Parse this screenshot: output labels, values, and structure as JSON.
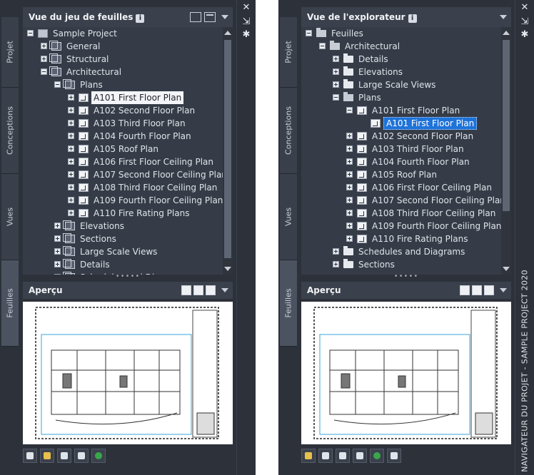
{
  "left": {
    "tabs": {
      "projet": "Projet",
      "conceptions": "Conceptions",
      "vues": "Vues",
      "feuilles": "Feuilles"
    },
    "title": "Vue du jeu de feuilles",
    "info": "i",
    "tree": [
      {
        "text": "Sample Project",
        "icon": "sheet-set-icon",
        "expander": "minus",
        "level": 0
      },
      {
        "text": "General",
        "icon": "subset-icon",
        "expander": "plus",
        "level": 1
      },
      {
        "text": "Structural",
        "icon": "subset-icon",
        "expander": "plus",
        "level": 1
      },
      {
        "text": "Architectural",
        "icon": "subset-icon",
        "expander": "minus",
        "level": 1
      },
      {
        "text": "Plans",
        "icon": "subset-icon",
        "expander": "minus",
        "level": 2
      },
      {
        "text": "A101 First Floor Plan",
        "icon": "sheet-icon",
        "expander": "plus",
        "level": 3,
        "selected": "gray"
      },
      {
        "text": "A102 Second Floor Plan",
        "icon": "sheet-icon",
        "expander": "plus",
        "level": 3
      },
      {
        "text": "A103 Third Floor Plan",
        "icon": "sheet-icon",
        "expander": "plus",
        "level": 3
      },
      {
        "text": "A104 Fourth Floor Plan",
        "icon": "sheet-icon",
        "expander": "plus",
        "level": 3
      },
      {
        "text": "A105 Roof Plan",
        "icon": "sheet-icon",
        "expander": "plus",
        "level": 3
      },
      {
        "text": "A106 First Floor Ceiling Plan",
        "icon": "sheet-icon",
        "expander": "plus",
        "level": 3
      },
      {
        "text": "A107 Second Floor Ceiling Plan",
        "icon": "sheet-icon",
        "expander": "plus",
        "level": 3
      },
      {
        "text": "A108 Third Floor Ceiling Plan",
        "icon": "sheet-icon",
        "expander": "plus",
        "level": 3
      },
      {
        "text": "A109 Fourth Floor Ceiling Plan",
        "icon": "sheet-icon",
        "expander": "plus",
        "level": 3
      },
      {
        "text": "A110 Fire Rating Plans",
        "icon": "sheet-icon",
        "expander": "plus",
        "level": 3
      },
      {
        "text": "Elevations",
        "icon": "subset-icon",
        "expander": "plus",
        "level": 2
      },
      {
        "text": "Sections",
        "icon": "subset-icon",
        "expander": "plus",
        "level": 2
      },
      {
        "text": "Large Scale Views",
        "icon": "subset-icon",
        "expander": "plus",
        "level": 2
      },
      {
        "text": "Details",
        "icon": "subset-icon",
        "expander": "plus",
        "level": 2
      },
      {
        "text": "Schedules and Diagrams",
        "icon": "subset-icon",
        "expander": "plus",
        "level": 2
      }
    ],
    "preview_title": "Aperçu"
  },
  "right": {
    "tabs": {
      "projet": "Projet",
      "conceptions": "Conceptions",
      "vues": "Vues",
      "feuilles": "Feuilles"
    },
    "title": "Vue de l'explorateur",
    "info": "i",
    "tree": [
      {
        "text": "Feuilles",
        "icon": "folder-open-icon",
        "expander": "minus",
        "level": 0
      },
      {
        "text": "Architectural",
        "icon": "folder-open-icon",
        "expander": "minus",
        "level": 1
      },
      {
        "text": "Details",
        "icon": "folder-icon",
        "expander": "plus",
        "level": 2
      },
      {
        "text": "Elevations",
        "icon": "folder-icon",
        "expander": "plus",
        "level": 2
      },
      {
        "text": "Large Scale Views",
        "icon": "folder-icon",
        "expander": "plus",
        "level": 2
      },
      {
        "text": "Plans",
        "icon": "folder-open-icon",
        "expander": "minus",
        "level": 2
      },
      {
        "text": "A101 First Floor Plan",
        "icon": "sheet-icon",
        "expander": "minus",
        "level": 3
      },
      {
        "text": "A101 First Floor Plan",
        "icon": "sheet-icon",
        "expander": "",
        "level": 4,
        "selected": "blue"
      },
      {
        "text": "A102 Second Floor Plan",
        "icon": "sheet-icon",
        "expander": "plus",
        "level": 3
      },
      {
        "text": "A103 Third Floor Plan",
        "icon": "sheet-icon",
        "expander": "plus",
        "level": 3
      },
      {
        "text": "A104 Fourth Floor Plan",
        "icon": "sheet-icon",
        "expander": "plus",
        "level": 3
      },
      {
        "text": "A105 Roof Plan",
        "icon": "sheet-icon",
        "expander": "plus",
        "level": 3
      },
      {
        "text": "A106 First Floor Ceiling Plan",
        "icon": "sheet-icon",
        "expander": "plus",
        "level": 3
      },
      {
        "text": "A107 Second Floor Ceiling Plan",
        "icon": "sheet-icon",
        "expander": "plus",
        "level": 3
      },
      {
        "text": "A108 Third Floor Ceiling Plan",
        "icon": "sheet-icon",
        "expander": "plus",
        "level": 3
      },
      {
        "text": "A109 Fourth Floor Ceiling Plan",
        "icon": "sheet-icon",
        "expander": "plus",
        "level": 3
      },
      {
        "text": "A110 Fire Rating Plans",
        "icon": "sheet-icon",
        "expander": "plus",
        "level": 3
      },
      {
        "text": "Schedules and Diagrams",
        "icon": "folder-icon",
        "expander": "plus",
        "level": 2
      },
      {
        "text": "Sections",
        "icon": "folder-icon",
        "expander": "plus",
        "level": 2
      }
    ],
    "preview_title": "Aperçu",
    "strip_title": "NAVIGATEUR DU PROJET - SAMPLE PROJECT 2020"
  },
  "colors": {
    "panel": "#2c313a",
    "tree_bg": "#363c47",
    "selection": "#1e73d8"
  }
}
